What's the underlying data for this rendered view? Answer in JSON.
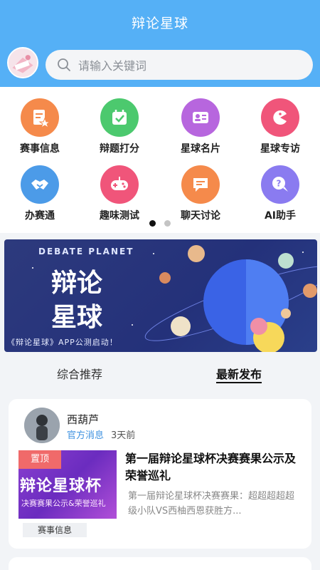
{
  "header": {
    "title": "辩论星球",
    "search_placeholder": "请输入关键词"
  },
  "menu": {
    "items": [
      {
        "label": "赛事信息",
        "icon": "document-star-icon",
        "color": "#f58a4b"
      },
      {
        "label": "辩题打分",
        "icon": "calendar-check-icon",
        "color": "#4cc96e"
      },
      {
        "label": "星球名片",
        "icon": "id-card-icon",
        "color": "#b766de"
      },
      {
        "label": "星球专访",
        "icon": "pacman-icon",
        "color": "#f0557a"
      },
      {
        "label": "办赛通",
        "icon": "handshake-icon",
        "color": "#4c9be8"
      },
      {
        "label": "趣味测试",
        "icon": "gamepad-icon",
        "color": "#f0557a"
      },
      {
        "label": "聊天讨论",
        "icon": "chat-icon",
        "color": "#f58a4b"
      },
      {
        "label": "AI助手",
        "icon": "help-chat-icon",
        "color": "#8a7bf0"
      }
    ],
    "pages": 2,
    "active_page": 1
  },
  "banner": {
    "en_title": "DEBATE PLANET",
    "zh_title": "辩论星球",
    "caption": "《辩论星球》APP公测启动！"
  },
  "tabs": [
    {
      "label": "综合推荐",
      "active": false
    },
    {
      "label": "最新发布",
      "active": true
    }
  ],
  "posts": [
    {
      "author": "西葫芦",
      "tag": "官方消息",
      "time": "3天前",
      "pin_label": "置顶",
      "thumb_title": "辩论星球杯",
      "thumb_subtitle": "决赛赛果公示&荣誉巡礼",
      "category": "赛事信息",
      "title": "第一届辩论星球杯决赛赛果公示及荣誉巡礼",
      "excerpt": "第一届辩论星球杯决赛赛果：超超超超超级小队VS西柚西恩获胜方..."
    }
  ],
  "colors": {
    "header_bg": "#55b0f6",
    "tag_blue": "#3f92e0",
    "pin_red": "#f06a6a"
  }
}
